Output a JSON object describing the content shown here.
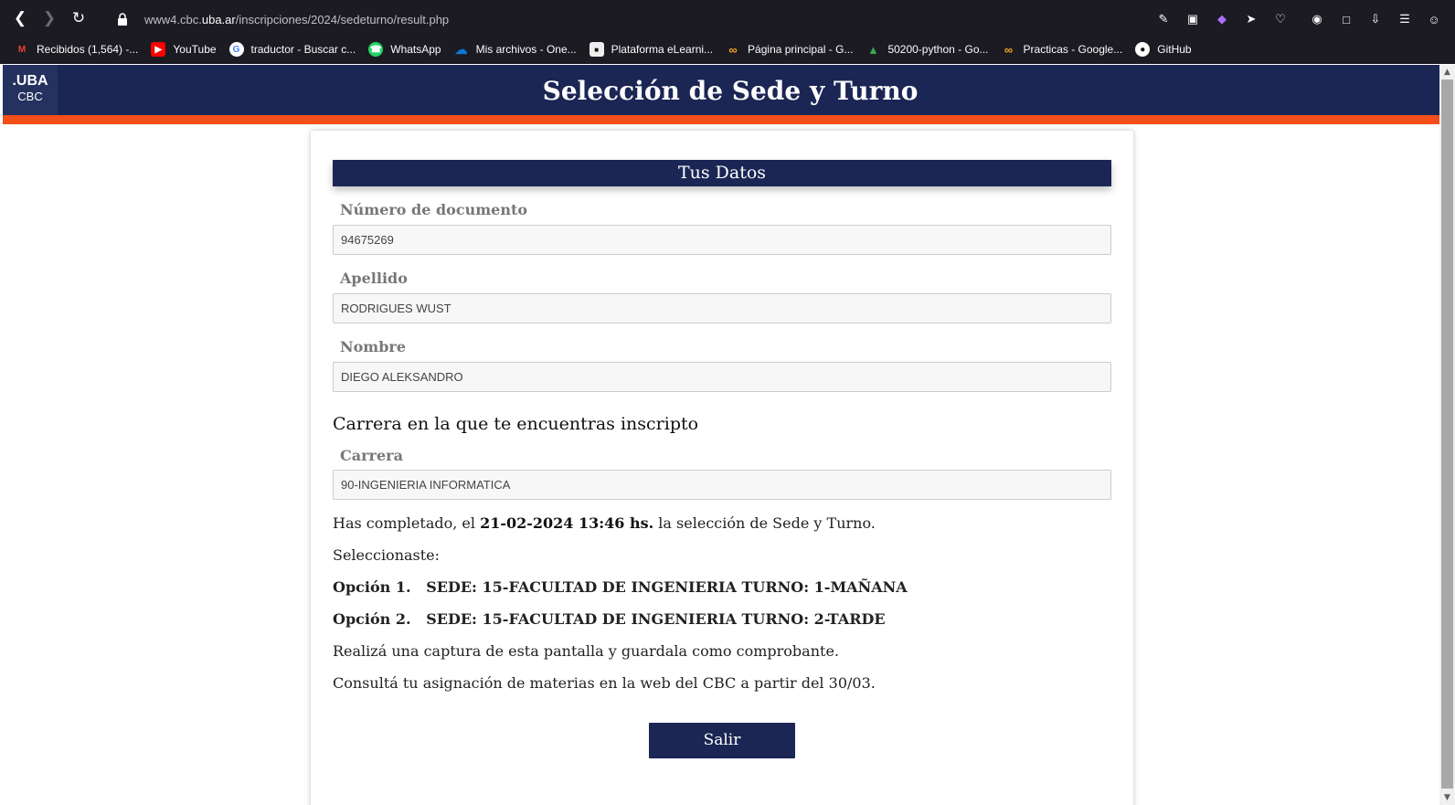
{
  "browser": {
    "url_prefix": "www4.cbc.",
    "url_domain": "uba.ar",
    "url_path": "/inscripciones/2024/sedeturno/result.php",
    "bookmarks": [
      {
        "label": "Recibidos (1,564) -...",
        "icon": "gmail-icon",
        "color": "#ea4335"
      },
      {
        "label": "YouTube",
        "icon": "youtube-icon",
        "color": "#ff0000"
      },
      {
        "label": "traductor - Buscar c...",
        "icon": "google-icon",
        "color": "#ffffff"
      },
      {
        "label": "WhatsApp",
        "icon": "whatsapp-icon",
        "color": "#25d366"
      },
      {
        "label": "Mis archivos - One...",
        "icon": "onedrive-icon",
        "color": "#0a78d4"
      },
      {
        "label": "Plataforma eLearni...",
        "icon": "elearning-icon",
        "color": "#222222"
      },
      {
        "label": "Página principal - G...",
        "icon": "coursera-icon",
        "color": "#f5a623"
      },
      {
        "label": "50200-python - Go...",
        "icon": "drive-icon",
        "color": "#4285f4"
      },
      {
        "label": "Practicas - Google...",
        "icon": "coursera-icon",
        "color": "#f5a623"
      },
      {
        "label": "GitHub",
        "icon": "github-icon",
        "color": "#ffffff"
      }
    ]
  },
  "site": {
    "logo_line1": ".UBA",
    "logo_line2": "CBC",
    "title": "Selección de Sede y Turno"
  },
  "form": {
    "section_title": "Tus Datos",
    "doc_label": "Número de documento",
    "doc_value": "94675269",
    "apellido_label": "Apellido",
    "apellido_value": "RODRIGUES WUST",
    "nombre_label": "Nombre",
    "nombre_value": "DIEGO ALEKSANDRO",
    "carrera_heading": "Carrera en la que te encuentras inscripto",
    "carrera_label": "Carrera",
    "carrera_value": "90-INGENIERIA INFORMATICA"
  },
  "result": {
    "completed_pre": "Has completado, el ",
    "completed_date": "21-02-2024 13:46 hs.",
    "completed_post": " la selección de Sede y Turno.",
    "seleccionaste": "Seleccionaste:",
    "opcion1": "Opción 1.   SEDE: 15-FACULTAD DE INGENIERIA TURNO: 1-MAÑANA",
    "opcion2": "Opción 2.   SEDE: 15-FACULTAD DE INGENIERIA TURNO: 2-TARDE",
    "captura": "Realizá una captura de esta pantalla y guardala como comprobante.",
    "consulta": "Consultá tu asignación de materias en la web del CBC a partir del 30/03.",
    "salir_label": "Salir"
  },
  "colors": {
    "header_navy": "#1b2654",
    "accent_orange": "#f24f1b"
  }
}
